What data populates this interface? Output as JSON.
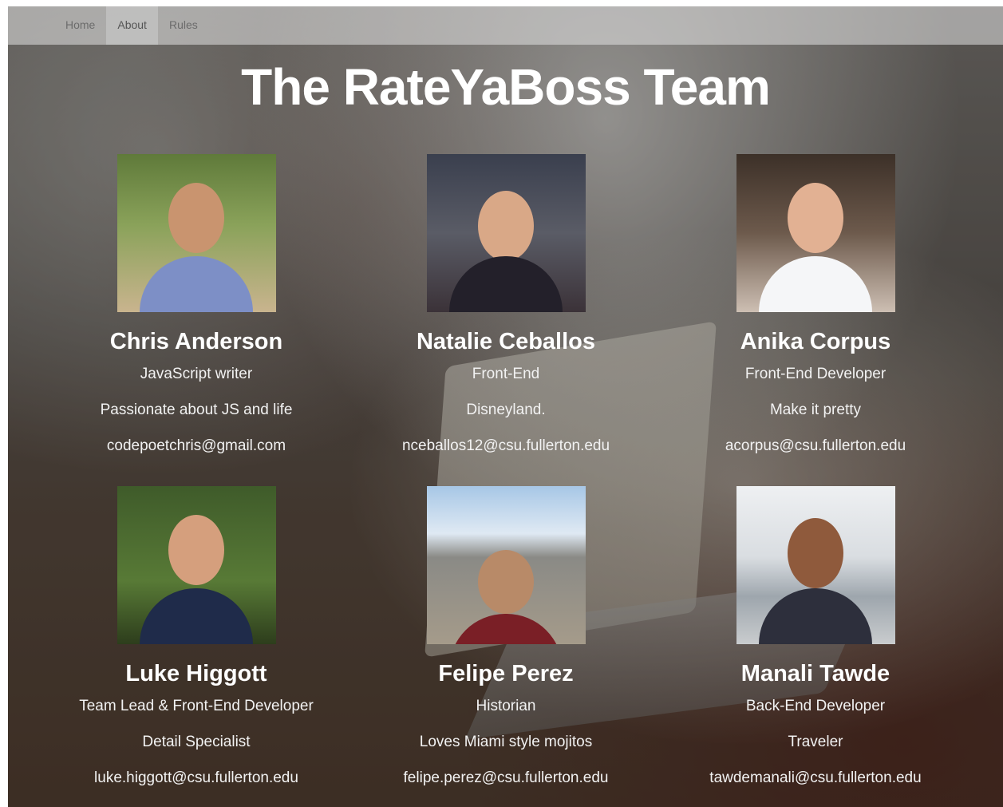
{
  "nav": {
    "items": [
      {
        "label": "Home"
      },
      {
        "label": "About"
      },
      {
        "label": "Rules"
      }
    ],
    "active": "About"
  },
  "page_title": "The RateYaBoss Team",
  "team": [
    {
      "name": "Chris Anderson",
      "role": "JavaScript writer",
      "tagline": "Passionate about JS and life",
      "email": "codepoetchris@gmail.com"
    },
    {
      "name": "Natalie Ceballos",
      "role": "Front-End",
      "tagline": "Disneyland.",
      "email": "nceballos12@csu.fullerton.edu"
    },
    {
      "name": "Anika Corpus",
      "role": "Front-End Developer",
      "tagline": "Make it pretty",
      "email": "acorpus@csu.fullerton.edu"
    },
    {
      "name": "Luke Higgott",
      "role": "Team Lead & Front-End Developer",
      "tagline": "Detail Specialist",
      "email": "luke.higgott@csu.fullerton.edu"
    },
    {
      "name": "Felipe Perez",
      "role": "Historian",
      "tagline": "Loves Miami style mojitos",
      "email": "felipe.perez@csu.fullerton.edu"
    },
    {
      "name": "Manali Tawde",
      "role": "Back-End Developer",
      "tagline": "Traveler",
      "email": "tawdemanali@csu.fullerton.edu"
    }
  ],
  "colors": {
    "title_text": "#ffffff",
    "navbar_bg": "#e1e1e1",
    "nav_text": "#6b6b6b"
  }
}
